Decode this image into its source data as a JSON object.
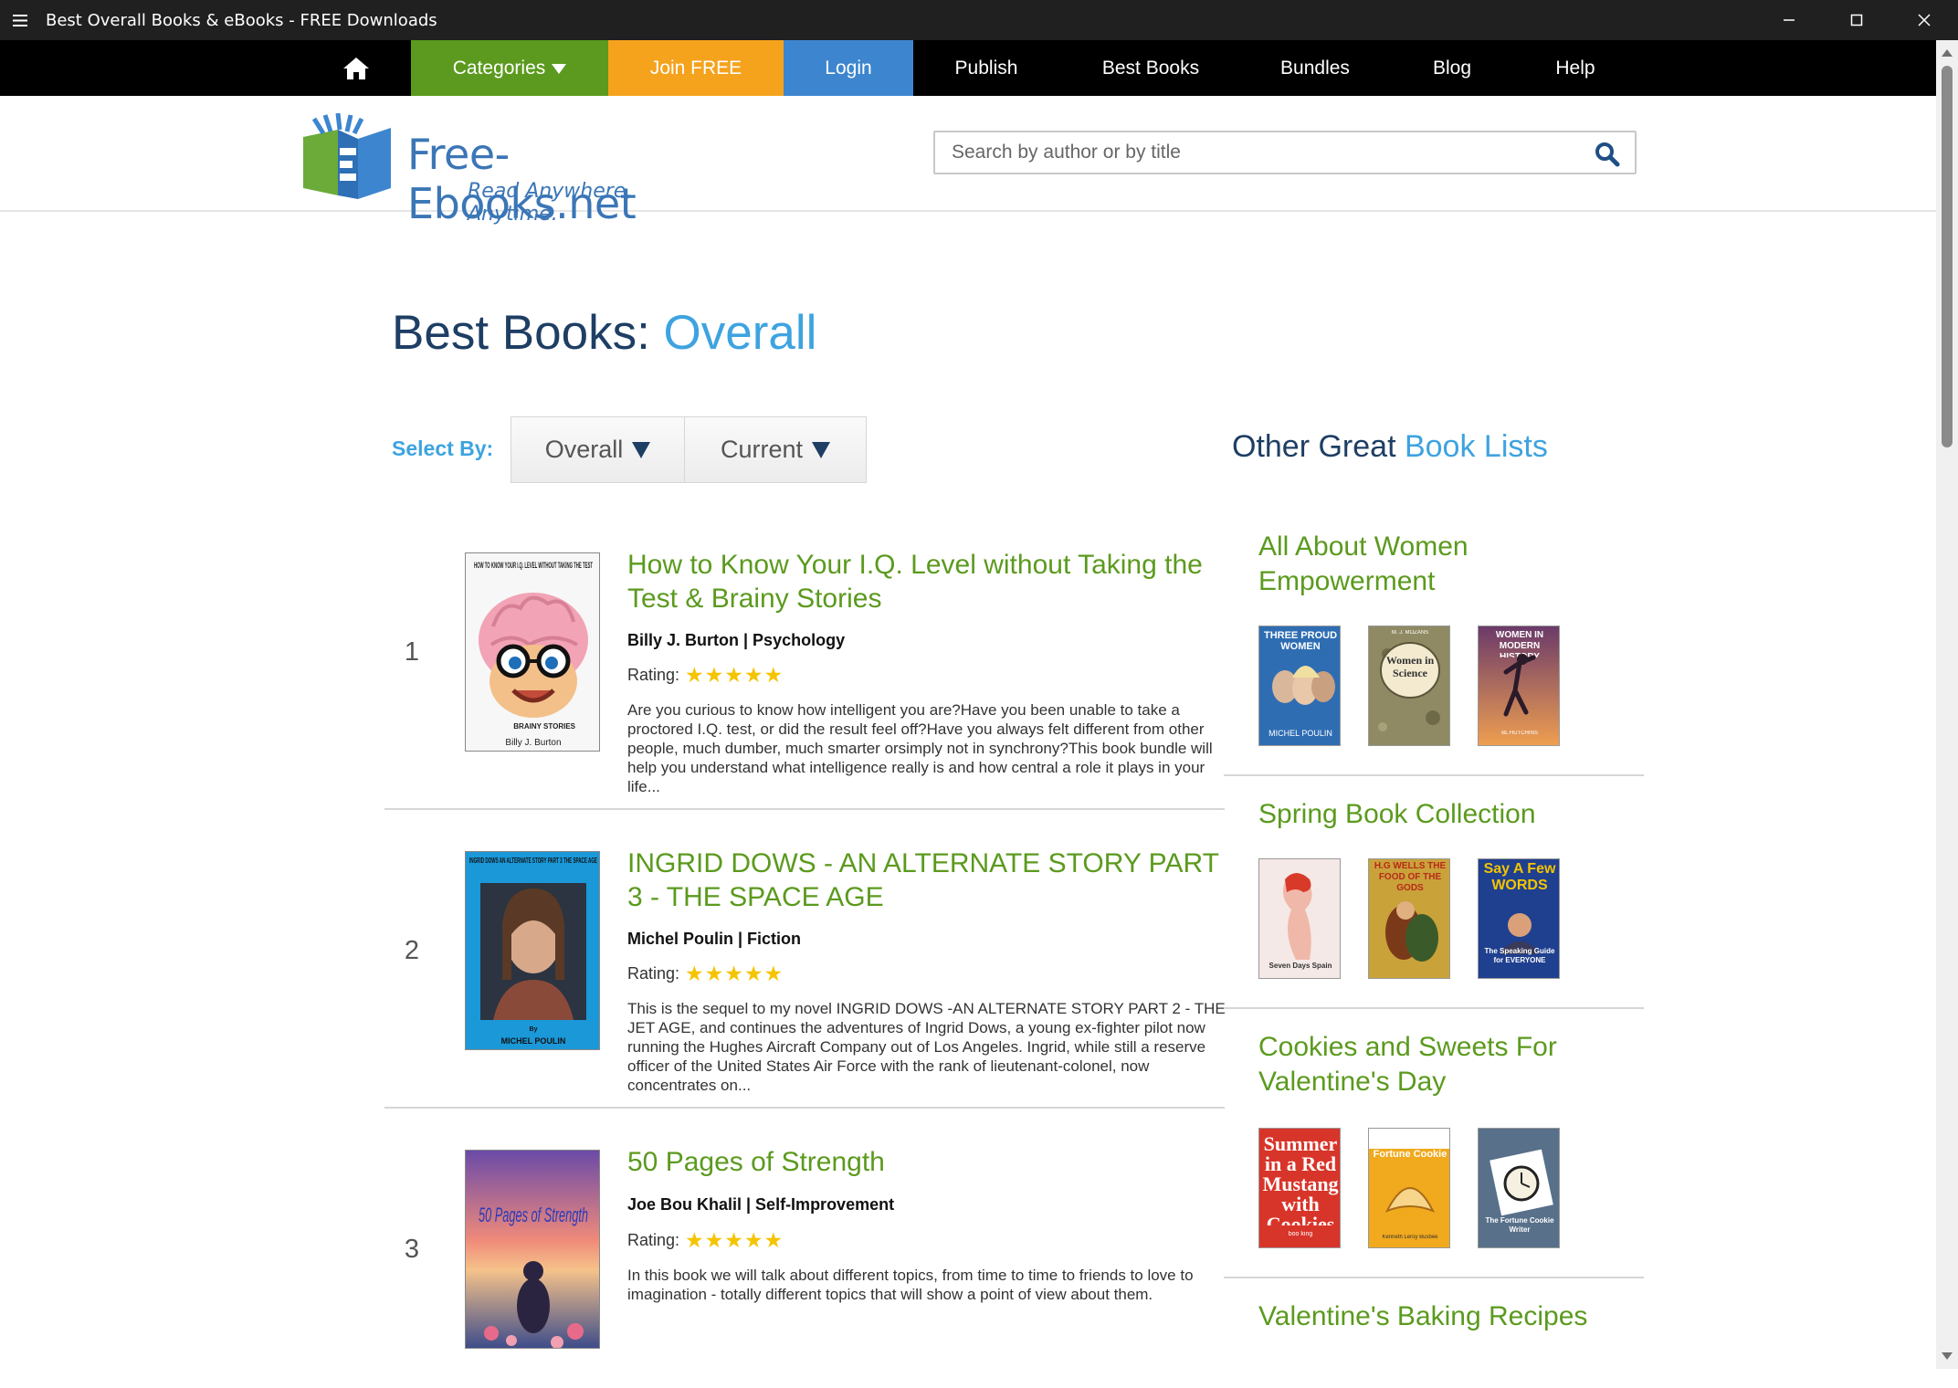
{
  "window": {
    "title": "Best Overall Books & eBooks - FREE Downloads",
    "controls": [
      "minimize",
      "maximize",
      "close"
    ]
  },
  "nav": {
    "home_icon": "home-icon",
    "categories": "Categories",
    "join": "Join FREE",
    "login": "Login",
    "publish": "Publish",
    "best_books": "Best Books",
    "bundles": "Bundles",
    "blog": "Blog",
    "help": "Help",
    "colors": {
      "categories": "#5b9a1e",
      "join": "#f5a21c",
      "login": "#3d86cf"
    }
  },
  "header": {
    "brand": "Free-Ebooks.net",
    "tagline": "Read Anywhere, Anytime.",
    "search_placeholder": "Search by author or by title"
  },
  "page": {
    "title_prefix": "Best Books:",
    "title_accent": "Overall",
    "select_by_label": "Select By:",
    "select_overall": "Overall",
    "select_current": "Current"
  },
  "books": [
    {
      "rank": "1",
      "title": "How to Know Your I.Q. Level without Taking the Test & Brainy Stories",
      "meta": "Billy J. Burton | Psychology",
      "rating_label": "Rating:",
      "stars": "★★★★★",
      "rating": 5,
      "description": "Are you curious to know how intelligent you are?Have you been unable to take a proctored I.Q. test, or did the result feel off?Have you always felt different from other people, much dumber, much smarter orsimply not in synchrony?This book bundle will help you understand what intelligence really is and how central a role it plays in your life...",
      "cover_title": "HOW TO KNOW YOUR I.Q. LEVEL WITHOUT TAKING THE TEST",
      "cover_sub": "BRAINY STORIES",
      "cover_author": "Billy J. Burton"
    },
    {
      "rank": "2",
      "title": "INGRID DOWS - AN ALTERNATE STORY PART 3 - THE SPACE AGE",
      "meta": "Michel Poulin | Fiction",
      "rating_label": "Rating:",
      "stars": "★★★★★",
      "rating": 5,
      "description": "This is the sequel to my novel INGRID DOWS -AN ALTERNATE STORY PART 2 - THE JET AGE, and continues the adventures of Ingrid Dows, a young ex-fighter pilot now running the Hughes Aircraft Company out of Los Angeles. Ingrid, while still a reserve officer of the United States Air Force with the rank of lieutenant-colonel, now concentrates on...",
      "cover_title": "INGRID DOWS AN ALTERNATE STORY PART 3 THE SPACE AGE",
      "cover_by": "By",
      "cover_author": "MICHEL POULIN"
    },
    {
      "rank": "3",
      "title": "50 Pages of Strength",
      "meta": "Joe Bou Khalil | Self-Improvement",
      "rating_label": "Rating:",
      "stars": "★★★★★",
      "rating": 5,
      "description": "In this book we will talk about different topics, from time to time to friends to love to imagination - totally different topics that will show a point of view about them.",
      "cover_title": "50 Pages of Strength"
    }
  ],
  "sidebar": {
    "heading_prefix": "Other Great",
    "heading_accent": "Book Lists",
    "lists": [
      {
        "title": "All About Women Empowerment",
        "covers": [
          {
            "text": "THREE PROUD WOMEN",
            "author": "MICHEL POULIN",
            "bg": "#2f6db3"
          },
          {
            "text": "Women in Science",
            "author": "M. J. MOZANS",
            "bg": "#8f8a63"
          },
          {
            "text": "WOMEN IN MODERN HISTORY",
            "author": "BL HUTCHINS",
            "bg": "#d9743a"
          }
        ]
      },
      {
        "title": "Spring Book Collection",
        "covers": [
          {
            "text": "Seven Days Spain",
            "bg": "#f4e9e6"
          },
          {
            "text": "H.G WELLS THE FOOD OF THE GODS",
            "bg": "#c9a23a"
          },
          {
            "text": "Say A Few WORDS",
            "sub": "The Speaking Guide for EVERYONE",
            "bg": "#1f3f8f"
          }
        ]
      },
      {
        "title": "Cookies and Sweets For Valentine's Day",
        "covers": [
          {
            "text": "Summer in a Red Mustang with Cookies",
            "author": "boo king",
            "bg": "#d8352a"
          },
          {
            "text": "Fortune Cookie",
            "author": "Kenneth Leroy Busbee",
            "bg": "#f1a91d"
          },
          {
            "text": "The Fortune Cookie Writer",
            "bg": "#58708a"
          }
        ]
      },
      {
        "title": "Valentine's Baking Recipes"
      }
    ]
  }
}
